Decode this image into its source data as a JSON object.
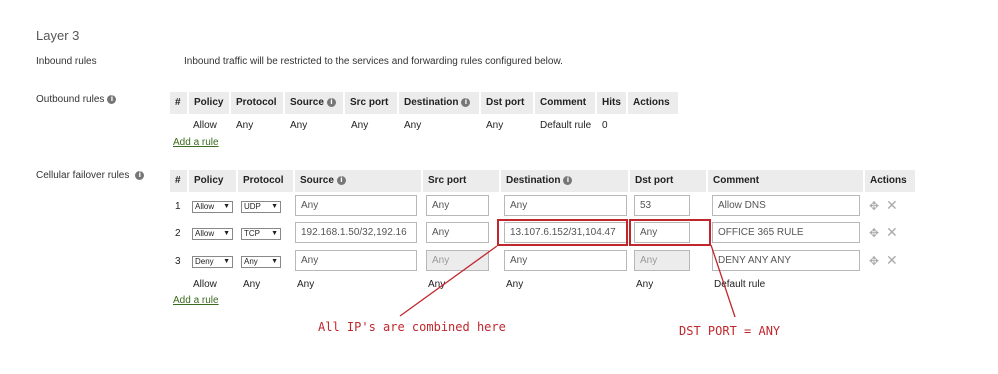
{
  "section_title": "Layer 3",
  "inbound": {
    "label": "Inbound rules",
    "text": "Inbound traffic will be restricted to the services and forwarding rules configured below."
  },
  "outbound": {
    "label": "Outbound rules",
    "headers": [
      "#",
      "Policy",
      "Protocol",
      "Source",
      "Src port",
      "Destination",
      "Dst port",
      "Comment",
      "Hits",
      "Actions"
    ],
    "default_row": {
      "policy": "Allow",
      "protocol": "Any",
      "source": "Any",
      "src_port": "Any",
      "destination": "Any",
      "dst_port": "Any",
      "comment": "Default rule",
      "hits": "0"
    },
    "add_rule": "Add a rule"
  },
  "cellular": {
    "label": "Cellular failover rules",
    "headers": [
      "#",
      "Policy",
      "Protocol",
      "Source",
      "Src port",
      "Destination",
      "Dst port",
      "Comment",
      "Actions"
    ],
    "rows": [
      {
        "num": "1",
        "policy": "Allow",
        "protocol": "UDP",
        "source": "Any",
        "src_port": "Any",
        "destination": "Any",
        "dst_port": "53",
        "comment": "Allow DNS"
      },
      {
        "num": "2",
        "policy": "Allow",
        "protocol": "TCP",
        "source": "192.168.1.50/32,192.16",
        "src_port": "Any",
        "destination": "13.107.6.152/31,104.47",
        "dst_port": "Any",
        "comment": "OFFICE 365 RULE"
      },
      {
        "num": "3",
        "policy": "Deny",
        "protocol": "Any",
        "source": "Any",
        "src_port": "Any",
        "destination": "Any",
        "dst_port": "Any",
        "comment": "DENY ANY ANY"
      }
    ],
    "default_row": {
      "policy": "Allow",
      "protocol": "Any",
      "source": "Any",
      "src_port": "Any",
      "destination": "Any",
      "dst_port": "Any",
      "comment": "Default rule"
    },
    "add_rule": "Add a rule"
  },
  "annotations": {
    "ip_note": "All IP's are combined here",
    "port_note": "DST PORT = ANY",
    "color": "#c0272d"
  },
  "icons": {
    "info": "info-icon",
    "move": "move-icon",
    "delete": "close-icon"
  }
}
